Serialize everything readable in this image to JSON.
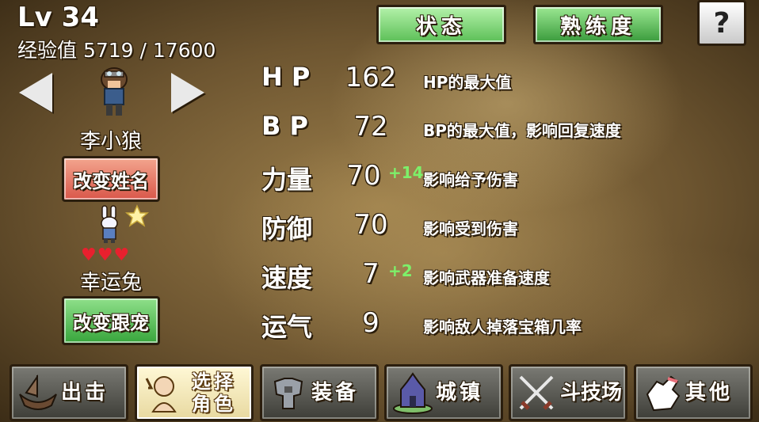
{
  "player": {
    "level": "Lv 34",
    "exp": "经验值 5719 / 17600",
    "name": "李小狼"
  },
  "buttons": {
    "rename": "改变姓名",
    "change_pet": "改变跟宠",
    "help": "?"
  },
  "pet": {
    "name": "幸运兔",
    "hearts": "♥♥♥",
    "hearts_count": 3
  },
  "tabs": {
    "status": "状态",
    "proficiency": "熟练度"
  },
  "stats": [
    {
      "label": "H P",
      "value": "162",
      "bonus": "",
      "desc": "HP的最大值"
    },
    {
      "label": "B P",
      "value": "72",
      "bonus": "",
      "desc": "BP的最大值，影响回复速度"
    },
    {
      "label": "力量",
      "value": "70",
      "bonus": "+14",
      "desc": "影响给予伤害"
    },
    {
      "label": "防御",
      "value": "70",
      "bonus": "",
      "desc": "影响受到伤害"
    },
    {
      "label": "速度",
      "value": "7",
      "bonus": "+2",
      "desc": "影响武器准备速度"
    },
    {
      "label": "运气",
      "value": "9",
      "bonus": "",
      "desc": "影响敌人掉落宝箱几率"
    }
  ],
  "nav": [
    {
      "label": "出击",
      "icon": "ship-icon"
    },
    {
      "label": "选择角色",
      "icon": "character-select-icon"
    },
    {
      "label": "装备",
      "icon": "armor-icon"
    },
    {
      "label": "城镇",
      "icon": "castle-icon"
    },
    {
      "label": "斗技场",
      "icon": "crossed-swords-icon"
    },
    {
      "label": "其他",
      "icon": "hand-icon"
    }
  ],
  "colors": {
    "bonus": "#7df06a",
    "heart": "#e8202e",
    "tab_green": "#3a9b3c",
    "rename_red": "#d9574a"
  }
}
